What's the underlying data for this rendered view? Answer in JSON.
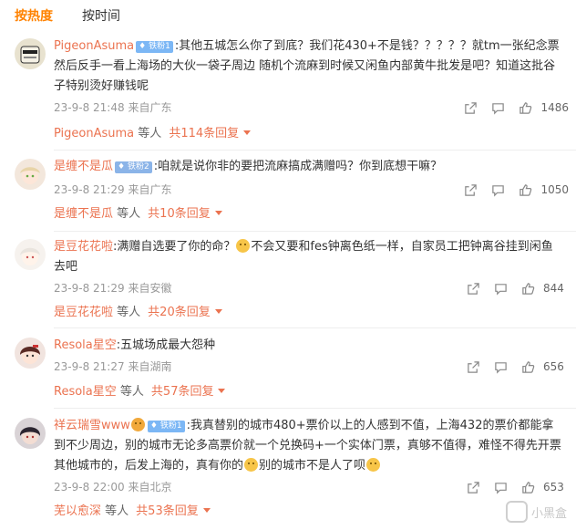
{
  "tabs": [
    {
      "label": "按热度",
      "active": true
    },
    {
      "label": "按时间",
      "active": false
    }
  ],
  "colors": {
    "accent": "#ff8200",
    "username": "#eb7350",
    "meta": "#999999"
  },
  "comments": [
    {
      "username": "PigeonAsuma",
      "badge": "铁粉1",
      "text": ":其他五城怎么你了到底？我们花430+不是钱？？？？？就tm一张纪念票然后反手一看上海场的大伙一袋子周边 随机个流麻到时候又闲鱼内部黄牛批发是吧？知道这批谷子特别烫好赚钱呢",
      "date": "23-9-8 21:48",
      "location": "来自广东",
      "likes": "1486",
      "reply_name": "PigeonAsuma",
      "reply_suffix": "等人",
      "reply_count": "共114条回复"
    },
    {
      "username": "是缠不是瓜",
      "badge": "铁粉2",
      "text": ":咱就是说你非的要把流麻搞成满赠吗？你到底想干嘛？",
      "date": "23-9-8 21:29",
      "location": "来自广东",
      "likes": "1050",
      "reply_name": "是缠不是瓜",
      "reply_suffix": "等人",
      "reply_count": "共10条回复"
    },
    {
      "username": "是豆花花啦",
      "text_before": ":满赠自选要了你的命？",
      "text_after": "不会又要和fes钟离色纸一样，自家员工把钟离谷挂到闲鱼去吧",
      "date": "23-9-8 21:29",
      "location": "来自安徽",
      "likes": "844",
      "reply_name": "是豆花花啦",
      "reply_suffix": "等人",
      "reply_count": "共20条回复"
    },
    {
      "username": "Resola星空",
      "text": ":五城场成最大怨种",
      "date": "23-9-8 21:27",
      "location": "来自湖南",
      "likes": "656",
      "reply_name": "Resola星空",
      "reply_suffix": "等人",
      "reply_count": "共57条回复"
    },
    {
      "username": "祥云瑞雪www",
      "badge": "铁粉1",
      "text_a": ":我真替别的城市480+票价以上的人感到不值，上海432的票价都能拿到不少周边，别的城市无论多高票价就一个兑换码+一个实体门票，真够不值得，难怪不得先开票其他城市的，后发上海的，真有你的",
      "text_b": "别的城市不是人了呗",
      "date": "23-9-8 22:00",
      "location": "来自北京",
      "likes": "653",
      "reply_name": "芜以愈深",
      "reply_suffix": "等人",
      "reply_count": "共53条回复"
    }
  ],
  "watermark": "小黑盒"
}
